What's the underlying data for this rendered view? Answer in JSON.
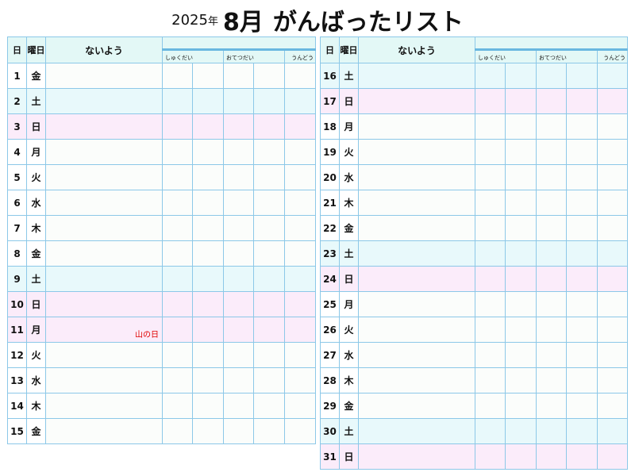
{
  "title": {
    "year": "2025",
    "year_kanji": "年",
    "month": "8月",
    "text": "がんばったリスト"
  },
  "headers": {
    "day": "日",
    "weekday": "曜日",
    "content": "ないよう",
    "sub": [
      "しゅくだい",
      "おてつだい",
      "うんどう"
    ]
  },
  "colors": {
    "grid": "#8cc8e8",
    "weekday_bg": "#fbfdfb",
    "saturday_bg": "#e8f9fb",
    "sunday_bg": "#fbecfa",
    "header_bg": "#e3f8f6",
    "holiday_text": "#e00000"
  },
  "days": [
    {
      "d": "1",
      "w": "金",
      "t": "weekday",
      "h": ""
    },
    {
      "d": "2",
      "w": "土",
      "t": "sat",
      "h": ""
    },
    {
      "d": "3",
      "w": "日",
      "t": "sun",
      "h": ""
    },
    {
      "d": "4",
      "w": "月",
      "t": "weekday",
      "h": ""
    },
    {
      "d": "5",
      "w": "火",
      "t": "weekday",
      "h": ""
    },
    {
      "d": "6",
      "w": "水",
      "t": "weekday",
      "h": ""
    },
    {
      "d": "7",
      "w": "木",
      "t": "weekday",
      "h": ""
    },
    {
      "d": "8",
      "w": "金",
      "t": "weekday",
      "h": ""
    },
    {
      "d": "9",
      "w": "土",
      "t": "sat",
      "h": ""
    },
    {
      "d": "10",
      "w": "日",
      "t": "sun",
      "h": ""
    },
    {
      "d": "11",
      "w": "月",
      "t": "hol",
      "h": "山の日"
    },
    {
      "d": "12",
      "w": "火",
      "t": "weekday",
      "h": ""
    },
    {
      "d": "13",
      "w": "水",
      "t": "weekday",
      "h": ""
    },
    {
      "d": "14",
      "w": "木",
      "t": "weekday",
      "h": ""
    },
    {
      "d": "15",
      "w": "金",
      "t": "weekday",
      "h": ""
    },
    {
      "d": "16",
      "w": "土",
      "t": "sat",
      "h": ""
    },
    {
      "d": "17",
      "w": "日",
      "t": "sun",
      "h": ""
    },
    {
      "d": "18",
      "w": "月",
      "t": "weekday",
      "h": ""
    },
    {
      "d": "19",
      "w": "火",
      "t": "weekday",
      "h": ""
    },
    {
      "d": "20",
      "w": "水",
      "t": "weekday",
      "h": ""
    },
    {
      "d": "21",
      "w": "木",
      "t": "weekday",
      "h": ""
    },
    {
      "d": "22",
      "w": "金",
      "t": "weekday",
      "h": ""
    },
    {
      "d": "23",
      "w": "土",
      "t": "sat",
      "h": ""
    },
    {
      "d": "24",
      "w": "日",
      "t": "sun",
      "h": ""
    },
    {
      "d": "25",
      "w": "月",
      "t": "weekday",
      "h": ""
    },
    {
      "d": "26",
      "w": "火",
      "t": "weekday",
      "h": ""
    },
    {
      "d": "27",
      "w": "水",
      "t": "weekday",
      "h": ""
    },
    {
      "d": "28",
      "w": "木",
      "t": "weekday",
      "h": ""
    },
    {
      "d": "29",
      "w": "金",
      "t": "weekday",
      "h": ""
    },
    {
      "d": "30",
      "w": "土",
      "t": "sat",
      "h": ""
    },
    {
      "d": "31",
      "w": "日",
      "t": "sun",
      "h": ""
    }
  ]
}
